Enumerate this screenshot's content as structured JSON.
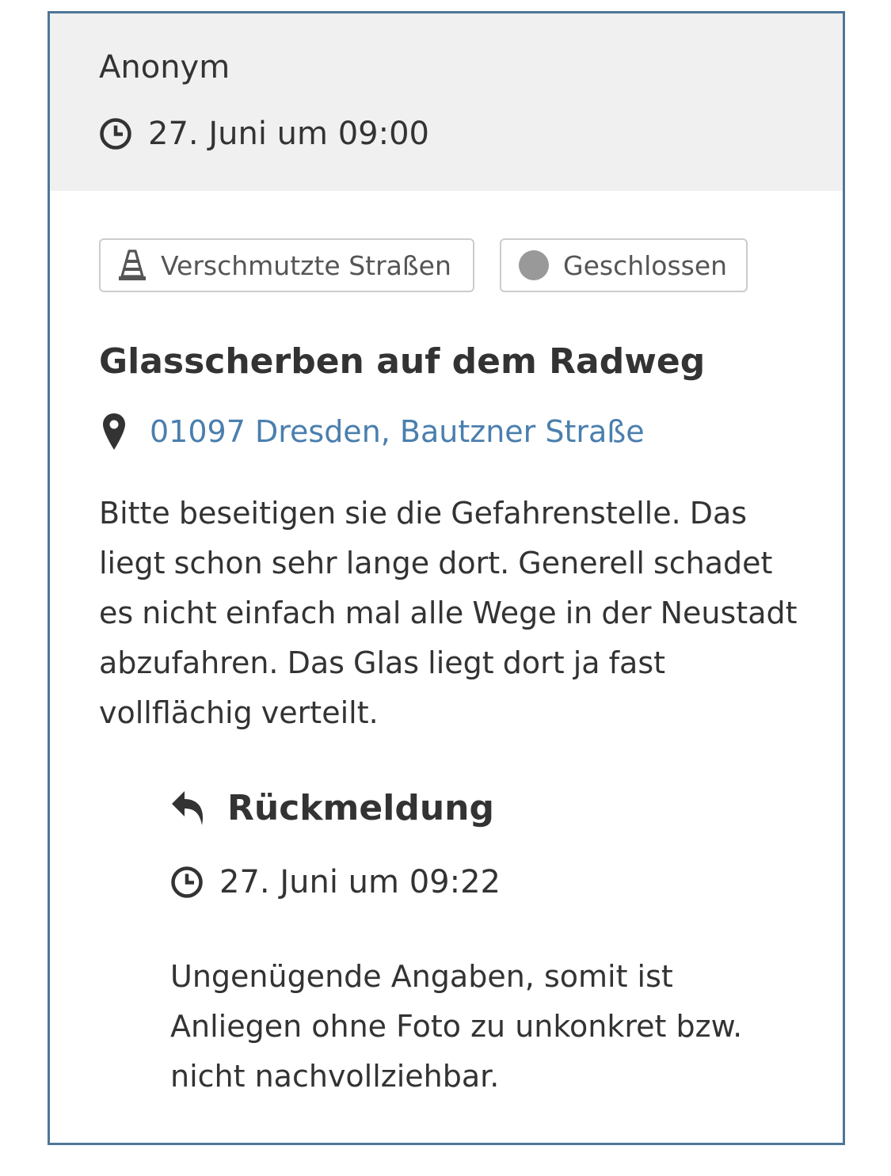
{
  "report": {
    "author": "Anonym",
    "created": "27. Juni um 09:00",
    "category": "Verschmutzte Straßen",
    "status": "Geschlossen",
    "title": "Glasscherben auf dem Radweg",
    "location": "01097 Dresden, Bautzner Straße",
    "description": "Bitte beseitigen sie die Gefahrenstelle. Das liegt schon sehr lange dort. Generell schadet es nicht einfach mal alle Wege in der Neu­stadt abzufahren. Das Glas liegt dort ja fast vollflächig verteilt."
  },
  "response": {
    "heading": "Rückmeldung",
    "created": "27. Juni um 09:22",
    "text": "Ungenügende Angaben, somit ist Anliegen ohne Foto zu unkonkret bzw. nicht nachvollziehbar."
  },
  "icons": {
    "clock": "clock-icon",
    "category": "traffic-cone-icon",
    "status": "status-dot-icon",
    "location": "map-pin-icon",
    "reply": "reply-arrow-icon"
  },
  "colors": {
    "border": "#4f7698",
    "header_bg": "#f0f0f0",
    "link": "#4a7fae",
    "status_dot": "#999999",
    "text": "#333333"
  }
}
